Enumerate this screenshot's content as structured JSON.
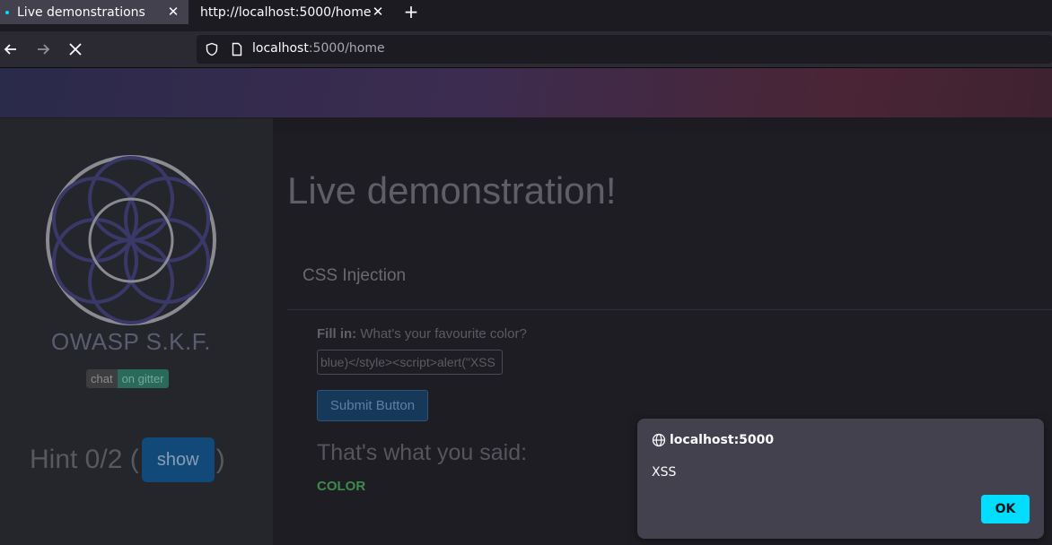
{
  "browser": {
    "tabs": [
      {
        "label": "Live demonstrations",
        "active": true
      },
      {
        "label": "http://localhost:5000/home",
        "active": false
      }
    ],
    "url": {
      "host": "localhost",
      "rest": ":5000/home"
    }
  },
  "sidebar": {
    "brand": "OWASP S.K.F.",
    "badge_left": "chat",
    "badge_right": "on gitter",
    "hint_prefix": "Hint 0/2 (",
    "hint_button": "show",
    "hint_suffix": ")"
  },
  "main": {
    "title": "Live demonstration!",
    "section": "CSS Injection",
    "fill_label_bold": "Fill in:",
    "fill_label_text": " What's your favourite color?",
    "input_value": "blue)</style><script>alert(\"XSS",
    "submit_label": "Submit Button",
    "said_heading": "That's what you said:",
    "output": "COLOR"
  },
  "dialog": {
    "origin": "localhost:5000",
    "message": "XSS",
    "ok_label": "OK"
  },
  "colors": {
    "accent": "#00ddff",
    "output_green": "#3c8c4a"
  }
}
